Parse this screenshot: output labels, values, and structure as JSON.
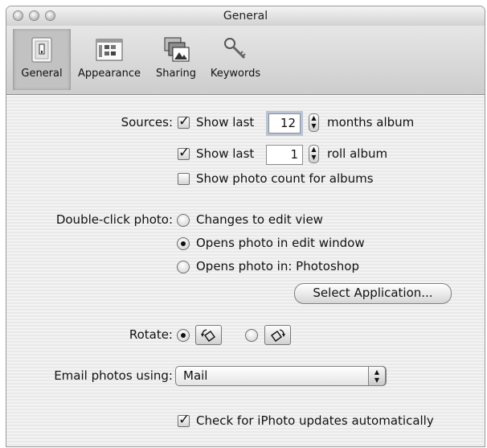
{
  "window": {
    "title": "General"
  },
  "toolbar": {
    "tabs": [
      {
        "label": "General",
        "icon": "general-prefs-icon",
        "selected": true
      },
      {
        "label": "Appearance",
        "icon": "appearance-icon",
        "selected": false
      },
      {
        "label": "Sharing",
        "icon": "sharing-icon",
        "selected": false
      },
      {
        "label": "Keywords",
        "icon": "keywords-icon",
        "selected": false
      }
    ]
  },
  "sources": {
    "label": "Sources:",
    "months": {
      "checked": true,
      "prefix": "Show last",
      "value": "12",
      "suffix": "months album"
    },
    "rolls": {
      "checked": true,
      "prefix": "Show last",
      "value": "1",
      "suffix": "roll album"
    },
    "photo_count": {
      "checked": false,
      "label": "Show photo count for albums"
    }
  },
  "double_click": {
    "label": "Double-click photo:",
    "options": [
      {
        "label": "Changes to edit view",
        "selected": false
      },
      {
        "label": "Opens photo in edit window",
        "selected": true
      },
      {
        "label": "Opens photo in: Photoshop",
        "selected": false
      }
    ],
    "select_app_button": "Select Application..."
  },
  "rotate": {
    "label": "Rotate:",
    "selected": "counterclockwise"
  },
  "email": {
    "label": "Email photos using:",
    "value": "Mail"
  },
  "updates": {
    "checked": true,
    "label": "Check for iPhoto updates automatically"
  }
}
